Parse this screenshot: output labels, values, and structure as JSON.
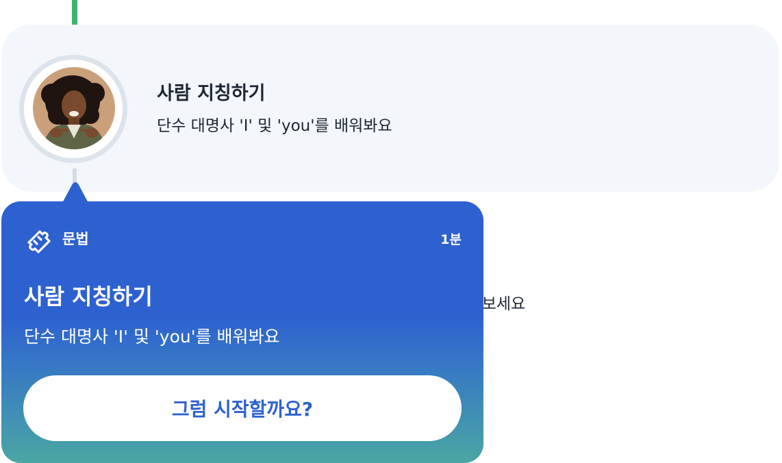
{
  "lesson": {
    "title": "사람 지칭하기",
    "subtitle": "단수 대명사 'I' 및 'you'를 배워봐요"
  },
  "background_text": "l 보세요",
  "popup": {
    "category_icon": "puzzle-piece-icon",
    "category": "문법",
    "duration": "1분",
    "title": "사람 지칭하기",
    "subtitle": "단수 대명사 'I' 및 'you'를 배워봐요",
    "start_button": "그럼 시작할까요?"
  },
  "colors": {
    "timeline_done": "#3db36b",
    "timeline_pending": "#d4dbe4",
    "card_bg": "#f3f6fa",
    "popup_blue": "#2d61cf",
    "popup_teal": "#4aa6a3"
  }
}
